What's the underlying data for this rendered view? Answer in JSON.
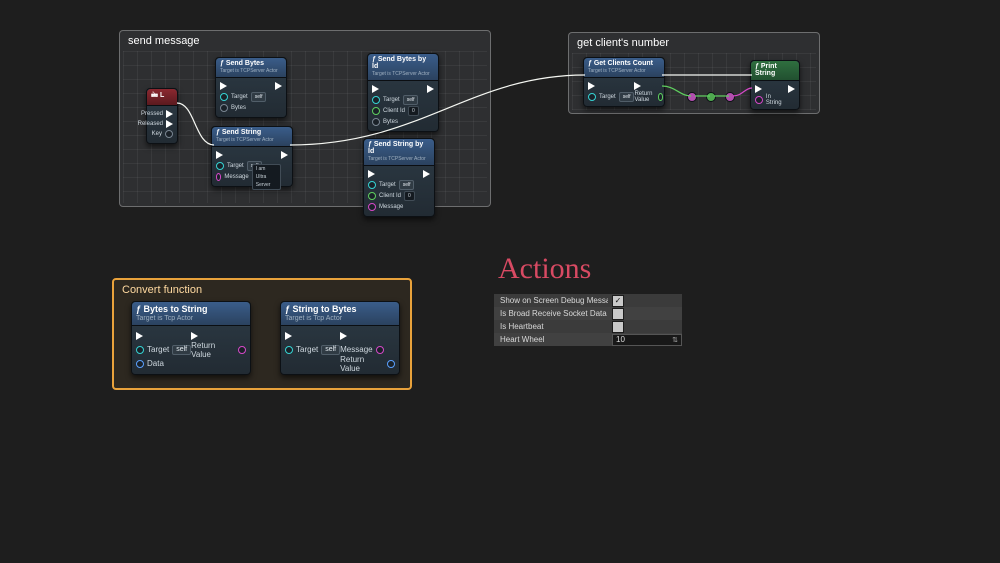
{
  "comments": {
    "send": {
      "title": "send message"
    },
    "clients": {
      "title": "get client's number"
    },
    "convert": {
      "title": "Convert function"
    }
  },
  "nodes": {
    "key": {
      "title": "L",
      "pins": {
        "pressed": "Pressed",
        "released": "Released",
        "key": "Key"
      }
    },
    "sendBytes": {
      "title": "Send Bytes",
      "sub": "Target is TCPServer Actor",
      "pins": {
        "target": "Target",
        "self": "self",
        "bytes": "Bytes"
      }
    },
    "sendBytesId": {
      "title": "Send Bytes by Id",
      "sub": "Target is TCPServer Actor",
      "pins": {
        "target": "Target",
        "self": "self",
        "clientId": "Client Id",
        "idVal": "0",
        "bytes": "Bytes"
      }
    },
    "sendString": {
      "title": "Send String",
      "sub": "Target is TCPServer Actor",
      "pins": {
        "target": "Target",
        "self": "self",
        "message": "Message",
        "msgVal": "I am Ultra Server"
      }
    },
    "sendStringId": {
      "title": "Send String by Id",
      "sub": "Target is TCPServer Actor",
      "pins": {
        "target": "Target",
        "self": "self",
        "clientId": "Client Id",
        "idVal": "0",
        "message": "Message"
      }
    },
    "getClients": {
      "title": "Get Clients Count",
      "sub": "Target is TCPServer Actor",
      "pins": {
        "target": "Target",
        "self": "self",
        "ret": "Return Value"
      }
    },
    "printString": {
      "title": "Print String",
      "pins": {
        "inString": "In String"
      }
    },
    "bytesToStr": {
      "title": "Bytes to String",
      "sub": "Target is Tcp Actor",
      "pins": {
        "target": "Target",
        "self": "self",
        "data": "Data",
        "ret": "Return Value"
      }
    },
    "strToBytes": {
      "title": "String to Bytes",
      "sub": "Target is Tcp Actor",
      "pins": {
        "target": "Target",
        "self": "self",
        "message": "Message",
        "ret": "Return Value"
      }
    }
  },
  "actions": {
    "heading": "Actions",
    "rows": {
      "show": {
        "label": "Show on Screen Debug Messages",
        "checked": true
      },
      "broad": {
        "label": "Is Broad Receive Socket Data Delegate",
        "checked": false
      },
      "hb": {
        "label": "Is Heartbeat",
        "checked": false
      },
      "wheel": {
        "label": "Heart Wheel",
        "value": "10"
      }
    }
  }
}
